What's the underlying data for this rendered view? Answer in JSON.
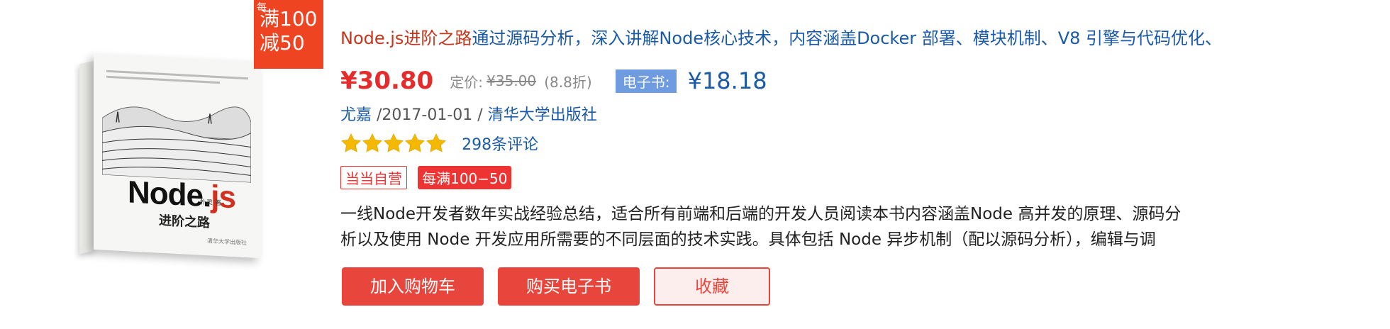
{
  "cover": {
    "title_main": "Node.",
    "title_js": "js",
    "subtitle": "进阶之路",
    "author": "朴灵 著",
    "publisher": "清华大学出版社"
  },
  "promo_badge": {
    "tag": "每",
    "line1": "满100",
    "line2": "减50"
  },
  "product": {
    "title_highlight": "Node.js进阶之路",
    "title_rest": "通过源码分析，深入讲解Node核心技术，内容涵盖Docker 部署、模块机制、V8 引擎与代码优化、",
    "price_now": "¥30.80",
    "price_label": "定价:",
    "price_original": "¥35.00",
    "discount": "(8.8折)",
    "ebook_label": "电子书:",
    "ebook_price": "¥18.18",
    "author": "尤嘉",
    "date": "/2017-01-01 /",
    "publisher": "清华大学出版社",
    "rating_stars": 5,
    "reviews": "298条评论",
    "badge_self": "当当自营",
    "badge_promo": "每满100−50",
    "desc_line1": "一线Node开发者数年实战经验总结，适合所有前端和后端的开发人员阅读本书内容涵盖Node 高并发的原理、源码分",
    "desc_line2": "析以及使用 Node 开发应用所需要的不同层面的技术实践。具体包括 Node 异步机制（配以源码分析），编辑与调"
  },
  "actions": {
    "add_cart": "加入购物车",
    "buy_ebook": "购买电子书",
    "favorite": "收藏"
  },
  "colors": {
    "price_red": "#e52b2b",
    "link_blue": "#1a5aa8",
    "button_red": "#e8453c",
    "star_gold": "#f5b800"
  },
  "icons": {
    "star": "star-icon"
  }
}
